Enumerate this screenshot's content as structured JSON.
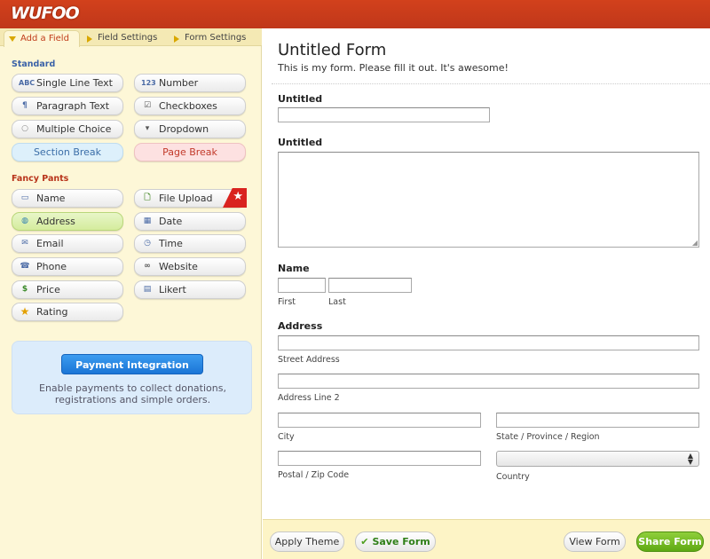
{
  "app": {
    "logo": "WUFOO"
  },
  "tabs": [
    {
      "label": "Add a Field"
    },
    {
      "label": "Field Settings"
    },
    {
      "label": "Form Settings"
    }
  ],
  "standard": {
    "heading": "Standard",
    "fields": [
      {
        "label": "Single Line Text",
        "icon": "ABC"
      },
      {
        "label": "Number",
        "icon": "123"
      },
      {
        "label": "Paragraph Text",
        "icon": "¶"
      },
      {
        "label": "Checkboxes",
        "icon": "☑"
      },
      {
        "label": "Multiple Choice",
        "icon": "○"
      },
      {
        "label": "Dropdown",
        "icon": "▾"
      },
      {
        "label": "Section Break"
      },
      {
        "label": "Page Break"
      }
    ]
  },
  "fancy": {
    "heading": "Fancy Pants",
    "fields": [
      {
        "label": "Name",
        "icon": "▭"
      },
      {
        "label": "File Upload",
        "icon": "🗋"
      },
      {
        "label": "Address",
        "icon": "◍"
      },
      {
        "label": "Date",
        "icon": "▦"
      },
      {
        "label": "Email",
        "icon": "✉"
      },
      {
        "label": "Time",
        "icon": "◷"
      },
      {
        "label": "Phone",
        "icon": "☎"
      },
      {
        "label": "Website",
        "icon": "∞"
      },
      {
        "label": "Price",
        "icon": "$"
      },
      {
        "label": "Likert",
        "icon": "▤"
      },
      {
        "label": "Rating",
        "icon": "★"
      }
    ],
    "ribbon_icon": "★"
  },
  "payment": {
    "button": "Payment Integration",
    "line1": "Enable payments to collect donations,",
    "line2": "registrations and simple orders."
  },
  "form": {
    "title": "Untitled Form",
    "description": "This is my form. Please fill it out. It's awesome!",
    "field1_label": "Untitled",
    "field2_label": "Untitled",
    "name_label": "Name",
    "first": "First",
    "last": "Last",
    "address_label": "Address",
    "street": "Street Address",
    "line2": "Address Line 2",
    "city": "City",
    "state": "State / Province / Region",
    "zip": "Postal / Zip Code",
    "country": "Country"
  },
  "bottom": {
    "apply_theme": "Apply Theme",
    "save_form": "Save Form",
    "view_form": "View Form",
    "share_form": "Share Form"
  },
  "colors": {
    "header": "#c83b1b",
    "panel": "#fdf7d7",
    "accent_green": "#6bb51d",
    "accent_blue": "#1f7bdc"
  }
}
